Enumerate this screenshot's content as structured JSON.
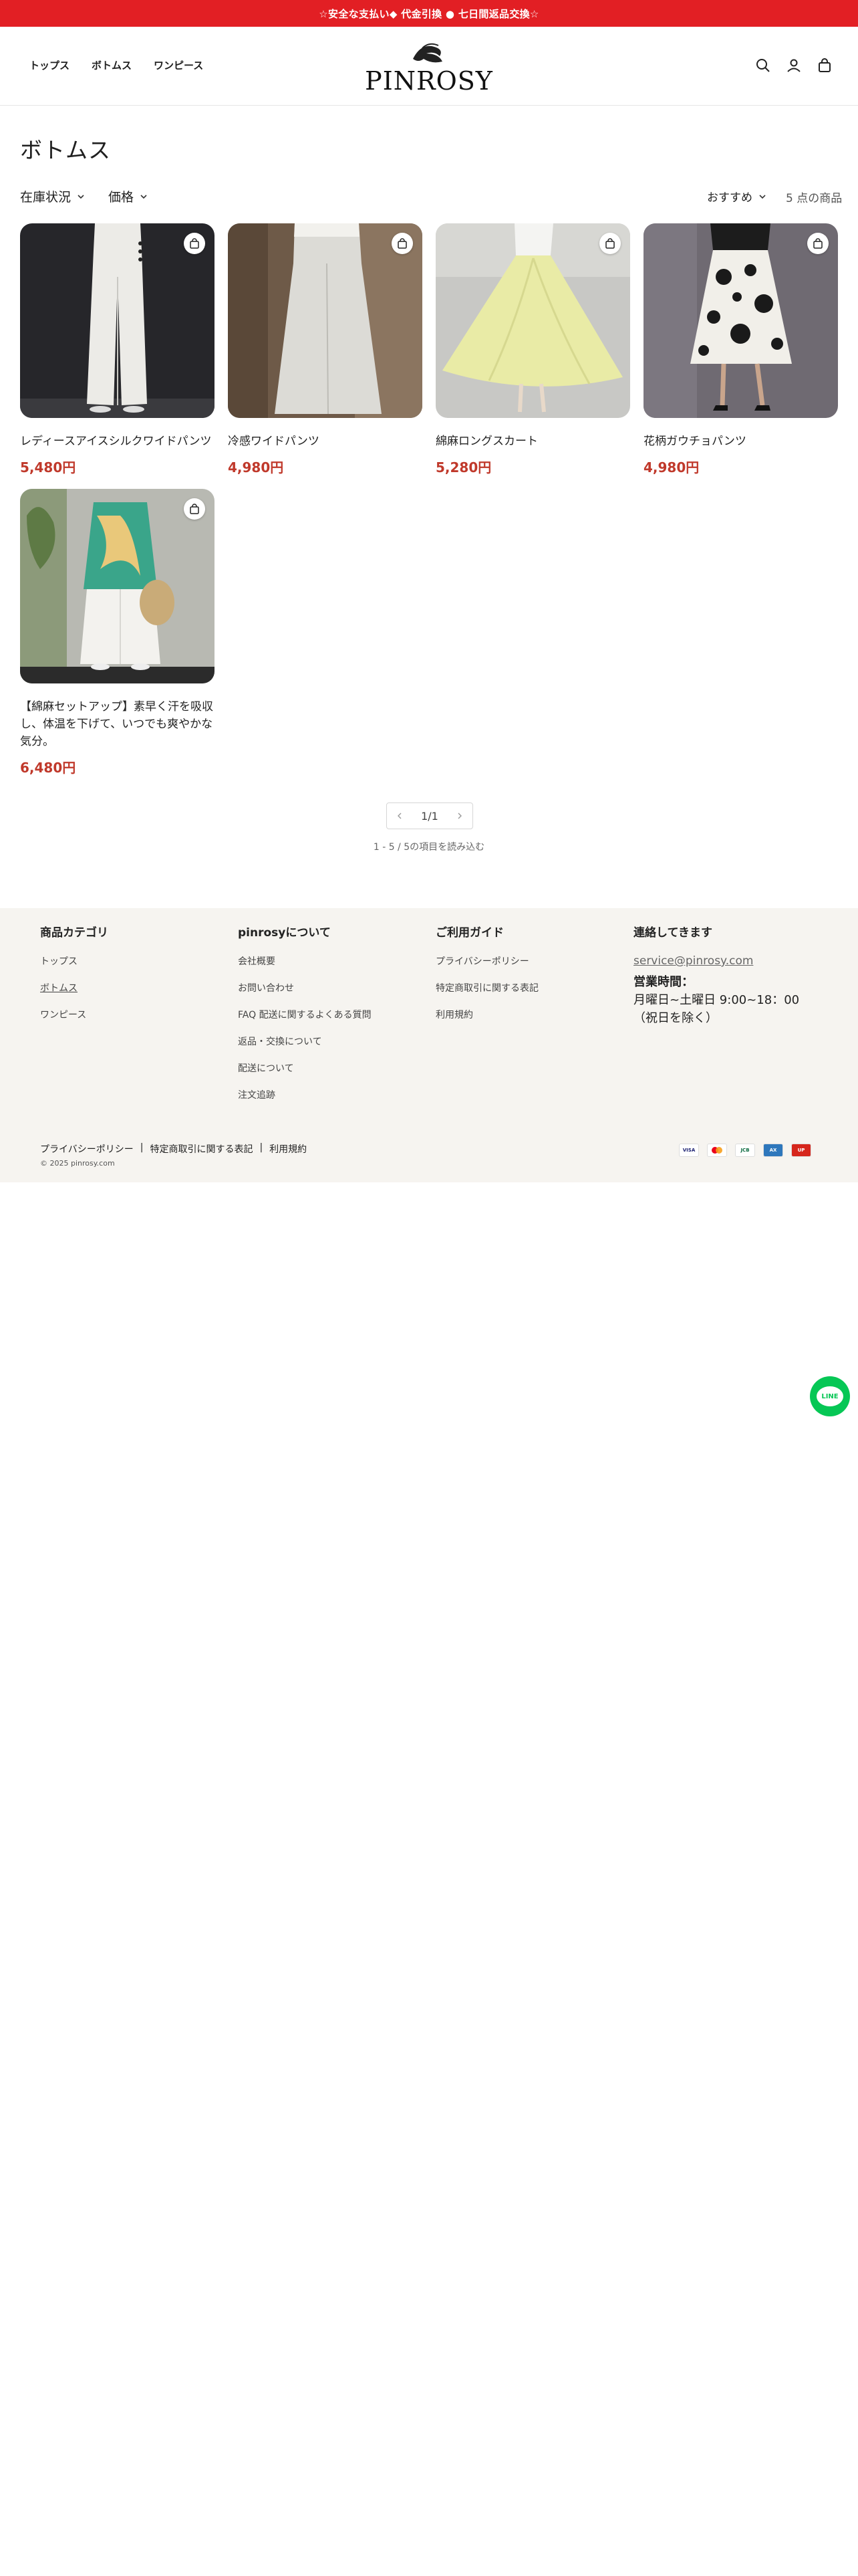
{
  "announcement": "☆安全な支払い◆ 代金引換 ● 七日間返品交換☆",
  "header": {
    "nav": [
      "トップス",
      "ボトムス",
      "ワンピース"
    ],
    "logo_text": "PINROSY",
    "icons": [
      "search-icon",
      "account-icon",
      "cart-icon"
    ]
  },
  "collection": {
    "title": "ボトムス",
    "filters": [
      "在庫状況",
      "価格"
    ],
    "sort_label": "おすすめ",
    "count": "5 点の商品"
  },
  "products": [
    {
      "name": "レディースアイスシルクワイドパンツ",
      "price": "5,480円"
    },
    {
      "name": "冷感ワイドパンツ",
      "price": "4,980円"
    },
    {
      "name": "綿麻ロングスカート",
      "price": "5,280円"
    },
    {
      "name": "花柄ガウチョパンツ",
      "price": "4,980円"
    },
    {
      "name": "【綿麻セットアップ】素早く汗を吸収し、体温を下げて、いつでも爽やかな気分。",
      "price": "6,480円"
    }
  ],
  "pagination": {
    "label": "1/1",
    "loaded": "1 - 5 / 5の項目を読み込む"
  },
  "footer": {
    "categories": {
      "title": "商品カテゴリ",
      "items": [
        "トップス",
        "ボトムス",
        "ワンピース"
      ]
    },
    "about": {
      "title": "pinrosyについて",
      "items": [
        "会社概要",
        "お問い合わせ",
        "FAQ 配送に関するよくある質問",
        "返品・交換について",
        "配送について",
        "注文追跡"
      ]
    },
    "guide": {
      "title": "ご利用ガイド",
      "items": [
        "プライバシーポリシー",
        "特定商取引に関する表記",
        "利用規約"
      ]
    },
    "contact": {
      "title": "連絡してきます",
      "email": "service@pinrosy.com",
      "hours_label": "営業時間：",
      "hours": "月曜日~土曜日 9:00~18：00",
      "note": "（祝日を除く）"
    },
    "bottom_links": [
      "プライバシーポリシー",
      "特定商取引に関する表記",
      "利用規約"
    ],
    "separator": "|",
    "copyright": "© 2025 pinrosy.com",
    "payments": [
      "VISA",
      "MC",
      "JCB",
      "AMEX",
      "UNION"
    ]
  },
  "line_button": "LINE",
  "colors": {
    "announce": "#e21f24",
    "price": "#c0392b",
    "footer_bg": "#f6f4f0",
    "line": "#06c755"
  }
}
